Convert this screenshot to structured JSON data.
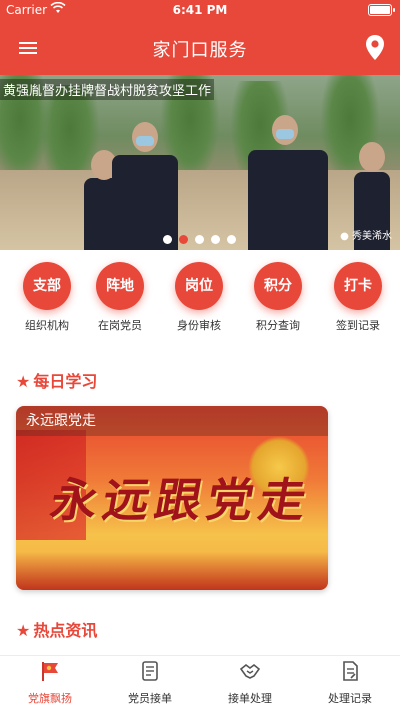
{
  "status_bar": {
    "carrier": "Carrier",
    "time": "6:41 PM"
  },
  "navbar": {
    "title": "家门口服务",
    "menu_icon": "menu-icon",
    "location_icon": "location-pin-icon"
  },
  "banner": {
    "caption": "黄强胤督办挂牌督战村脱贫攻坚工作",
    "watermark": "秀美浠水",
    "slide_count": 5,
    "active_slide": 2
  },
  "quick_actions": [
    {
      "circle": "支部",
      "label": "组织机构"
    },
    {
      "circle": "阵地",
      "label": "在岗党员"
    },
    {
      "circle": "岗位",
      "label": "身份审核"
    },
    {
      "circle": "积分",
      "label": "积分查询"
    },
    {
      "circle": "打卡",
      "label": "签到记录"
    }
  ],
  "daily_study": {
    "title": "每日学习",
    "card": {
      "title": "永远跟党走",
      "art_text": "永远跟党走"
    }
  },
  "hot_news": {
    "title": "热点资讯"
  },
  "tabbar": [
    {
      "label": "党旗飘扬",
      "icon": "party-flag-icon",
      "active": true
    },
    {
      "label": "党员接单",
      "icon": "order-icon",
      "active": false
    },
    {
      "label": "接单处理",
      "icon": "handshake-icon",
      "active": false
    },
    {
      "label": "处理记录",
      "icon": "record-icon",
      "active": false
    }
  ],
  "colors": {
    "accent": "#e8483a",
    "text": "#333333"
  }
}
